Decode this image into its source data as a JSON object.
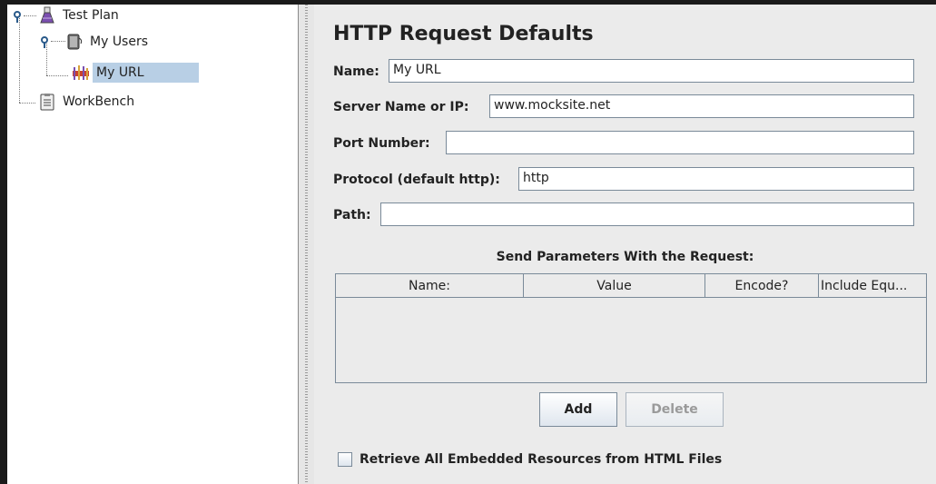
{
  "tree": {
    "items": [
      {
        "label": "Test Plan",
        "icon": "flask-icon"
      },
      {
        "label": "My Users",
        "icon": "thread-group-icon"
      },
      {
        "label": "My URL",
        "icon": "config-element-icon",
        "selected": true
      },
      {
        "label": "WorkBench",
        "icon": "clipboard-icon"
      }
    ]
  },
  "panel": {
    "title": "HTTP Request Defaults",
    "name_label": "Name:",
    "name_value": "My URL",
    "server_label": "Server Name or IP:",
    "server_value": "www.mocksite.net",
    "port_label": "Port Number:",
    "port_value": "",
    "protocol_label": "Protocol (default http):",
    "protocol_value": "http",
    "path_label": "Path:",
    "path_value": "",
    "params_title": "Send Parameters With the Request:",
    "columns": [
      "Name:",
      "Value",
      "Encode?",
      "Include Equ..."
    ],
    "add_label": "Add",
    "delete_label": "Delete",
    "retrieve_label": "Retrieve All Embedded Resources from HTML Files"
  },
  "colors": {
    "selection": "#b8cfe5",
    "panel_bg": "#ebebeb"
  }
}
